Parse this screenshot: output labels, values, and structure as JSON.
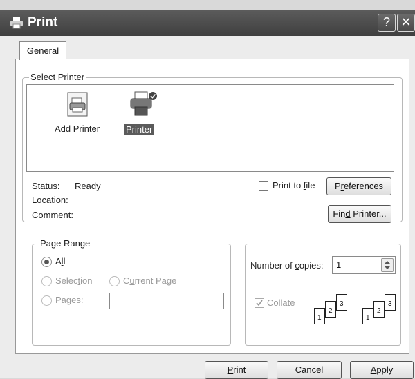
{
  "window": {
    "title": "Print",
    "help_glyph": "?",
    "close_glyph": "✕"
  },
  "tabs": [
    {
      "label": "General"
    }
  ],
  "select_printer": {
    "group_label": "Select Printer",
    "items": [
      {
        "label": "Add Printer"
      },
      {
        "label": "Printer",
        "selected": true
      }
    ]
  },
  "status": {
    "status_label": "Status:",
    "status_value": "Ready",
    "location_label": "Location:",
    "comment_label": "Comment:"
  },
  "print_to_file": {
    "pre": "Print to ",
    "accel": "f",
    "post": "ile",
    "checked": false
  },
  "preferences_button": {
    "pre": "P",
    "accel": "r",
    "post": "eferences"
  },
  "find_printer_button": {
    "pre": "Fin",
    "accel": "d",
    "post": " Printer..."
  },
  "page_range": {
    "group_label": "Page Range",
    "all": {
      "pre": "A",
      "accel": "l",
      "post": "l",
      "selected": true
    },
    "selection": {
      "pre": "Selec",
      "accel": "t",
      "post": "ion"
    },
    "current_page": {
      "pre": "C",
      "accel": "u",
      "post": "rrent Page"
    },
    "pages": {
      "pre": "Pa",
      "accel": "g",
      "post": "es:",
      "value": ""
    }
  },
  "copies": {
    "label_pre": "Number of ",
    "label_accel": "c",
    "label_post": "opies:",
    "value": "1",
    "collate": {
      "pre": "C",
      "accel": "o",
      "post": "llate",
      "checked": true
    },
    "collate_sets": [
      [
        "1",
        "2",
        "3"
      ],
      [
        "1",
        "2",
        "3"
      ]
    ]
  },
  "footer": {
    "print": {
      "pre": "",
      "accel": "P",
      "post": "rint"
    },
    "cancel": {
      "label": "Cancel"
    },
    "apply": {
      "pre": "",
      "accel": "A",
      "post": "pply"
    }
  }
}
